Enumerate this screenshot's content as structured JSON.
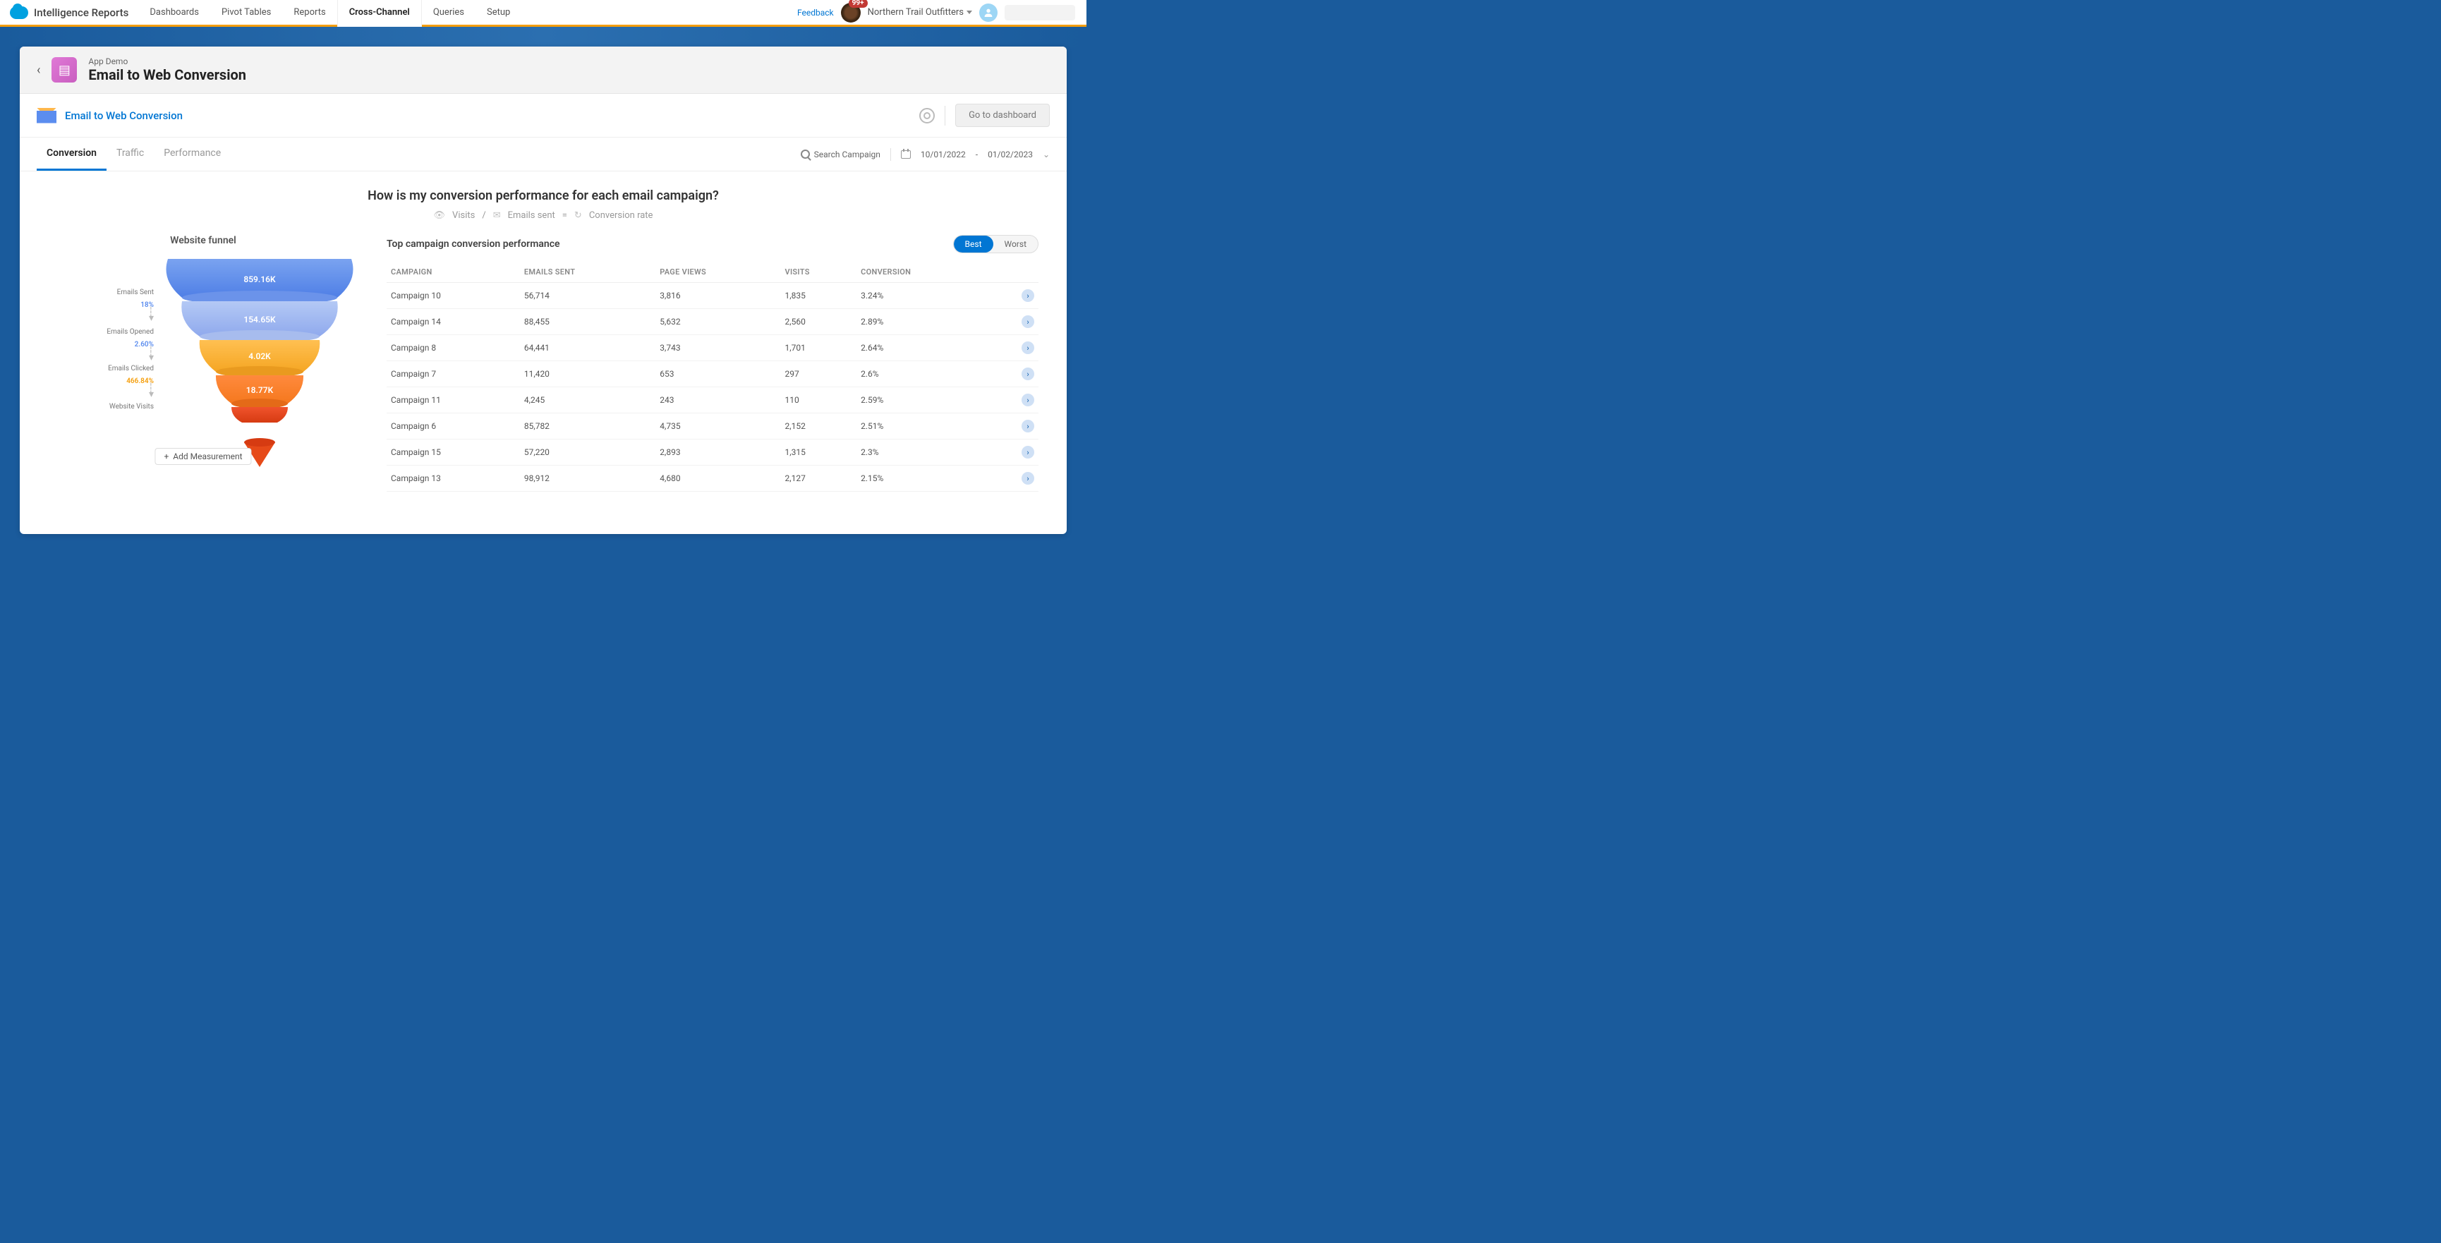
{
  "brand": "Intelligence Reports",
  "nav": {
    "tabs": [
      "Dashboards",
      "Pivot Tables",
      "Reports",
      "Cross-Channel",
      "Queries",
      "Setup"
    ],
    "active": "Cross-Channel",
    "feedback": "Feedback",
    "badge": "99+",
    "org": "Northern Trail Outfitters"
  },
  "header": {
    "crumb": "App Demo",
    "title": "Email to Web Conversion"
  },
  "subheader": {
    "title": "Email to Web Conversion",
    "goto": "Go to dashboard"
  },
  "subtabs": {
    "items": [
      "Conversion",
      "Traffic",
      "Performance"
    ],
    "active": "Conversion"
  },
  "search_campaign_label": "Search Campaign",
  "date_range": {
    "from": "10/01/2022",
    "sep": "-",
    "to": "01/02/2023"
  },
  "question": "How is my conversion performance for each email campaign?",
  "formula": {
    "visits": "Visits",
    "slash": "/",
    "emails": "Emails sent",
    "eq": "=",
    "rate": "Conversion rate"
  },
  "funnel": {
    "title": "Website funnel",
    "add_label": "Add Measurement",
    "stages": [
      {
        "label": "Emails Sent",
        "value": "859.16K",
        "pct": "18%",
        "pct_color": "blue"
      },
      {
        "label": "Emails Opened",
        "value": "154.65K",
        "pct": "2.60%",
        "pct_color": "blue"
      },
      {
        "label": "Emails Clicked",
        "value": "4.02K",
        "pct": "466.84%",
        "pct_color": "orange"
      },
      {
        "label": "Website Visits",
        "value": "18.77K",
        "pct": "",
        "pct_color": ""
      }
    ]
  },
  "table": {
    "title": "Top campaign conversion performance",
    "toggle": {
      "best": "Best",
      "worst": "Worst",
      "active": "Best"
    },
    "columns": [
      "CAMPAIGN",
      "EMAILS SENT",
      "PAGE VIEWS",
      "VISITS",
      "CONVERSION"
    ],
    "rows": [
      {
        "campaign": "Campaign 10",
        "emails": "56,714",
        "pv": "3,816",
        "visits": "1,835",
        "conv": "3.24%"
      },
      {
        "campaign": "Campaign 14",
        "emails": "88,455",
        "pv": "5,632",
        "visits": "2,560",
        "conv": "2.89%"
      },
      {
        "campaign": "Campaign 8",
        "emails": "64,441",
        "pv": "3,743",
        "visits": "1,701",
        "conv": "2.64%"
      },
      {
        "campaign": "Campaign 7",
        "emails": "11,420",
        "pv": "653",
        "visits": "297",
        "conv": "2.6%"
      },
      {
        "campaign": "Campaign 11",
        "emails": "4,245",
        "pv": "243",
        "visits": "110",
        "conv": "2.59%"
      },
      {
        "campaign": "Campaign 6",
        "emails": "85,782",
        "pv": "4,735",
        "visits": "2,152",
        "conv": "2.51%"
      },
      {
        "campaign": "Campaign 15",
        "emails": "57,220",
        "pv": "2,893",
        "visits": "1,315",
        "conv": "2.3%"
      },
      {
        "campaign": "Campaign 13",
        "emails": "98,912",
        "pv": "4,680",
        "visits": "2,127",
        "conv": "2.15%"
      }
    ]
  },
  "chart_data": {
    "type": "funnel",
    "title": "Website funnel",
    "stages": [
      "Emails Sent",
      "Emails Opened",
      "Emails Clicked",
      "Website Visits"
    ],
    "values": [
      859160,
      154650,
      4020,
      18770
    ],
    "value_labels": [
      "859.16K",
      "154.65K",
      "4.02K",
      "18.77K"
    ],
    "step_pct": [
      "18%",
      "2.60%",
      "466.84%"
    ],
    "colors": [
      "#5b8def",
      "#9bb8f3",
      "#f5a623",
      "#f5781e",
      "#e64a19"
    ]
  }
}
